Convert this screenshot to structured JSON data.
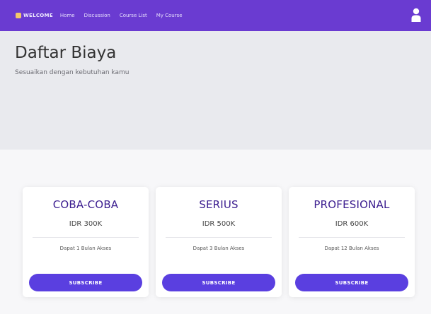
{
  "navbar": {
    "brand": "WELCOME",
    "links": [
      "Home",
      "Discussion",
      "Course List",
      "My Course"
    ],
    "user_icon": "user-icon"
  },
  "hero": {
    "title": "Daftar Biaya",
    "subtitle": "Sesuaikan dengan kebutuhan kamu"
  },
  "plans": [
    {
      "name": "COBA-COBA",
      "price": "IDR 300K",
      "access": "Dapat 1 Bulan Akses",
      "button": "SUBSCRIBE"
    },
    {
      "name": "SERIUS",
      "price": "IDR 500K",
      "access": "Dapat 3 Bulan Akses",
      "button": "SUBSCRIBE"
    },
    {
      "name": "PROFESIONAL",
      "price": "IDR 600K",
      "access": "Dapat 12 Bulan Akses",
      "button": "SUBSCRIBE"
    }
  ],
  "colors": {
    "navbar": "#6a3bd1",
    "hero_background": "#e9eaee",
    "plan_title": "#3b1d8f",
    "button": "#5a3fe0"
  }
}
